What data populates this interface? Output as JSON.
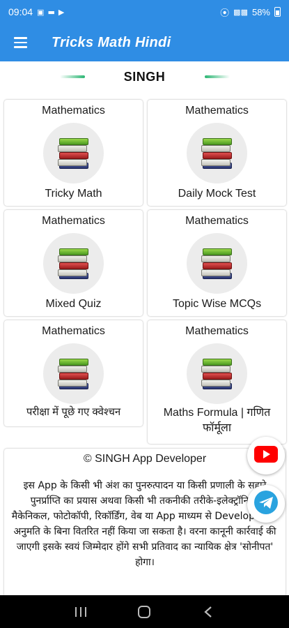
{
  "status_bar": {
    "time": "09:04",
    "battery": "58%"
  },
  "app_bar": {
    "title": "Tricks Math Hindi"
  },
  "section": {
    "title": "SINGH"
  },
  "cards": [
    {
      "category": "Mathematics",
      "label": "Tricky Math"
    },
    {
      "category": "Mathematics",
      "label": "Daily Mock Test"
    },
    {
      "category": "Mathematics",
      "label": "Mixed Quiz"
    },
    {
      "category": "Mathematics",
      "label": "Topic Wise MCQs"
    },
    {
      "category": "Mathematics",
      "label": "परीक्षा में पूछे गए क्वेश्चन"
    },
    {
      "category": "Mathematics",
      "label": "Maths Formula | गणित फॉर्मूला"
    }
  ],
  "footer": {
    "copyright": "© SINGH App Developer",
    "disclaimer": "इस App के किसी भी अंश का पुनरुत्पादन या किसी प्रणाली के सहारे पुनर्प्राप्ति का प्रयास अथवा किसी भी तकनीकी तरीके-इलेक्ट्रॉनिक, मैकेनिकल, फोटोकॉपी, रिकॉर्डिंग, वेब या App माध्यम से Developer की अनुमति के बिना वितरित नहीं किया जा सकता है। वरना कानूनी कार्रवाई की जाएगी इसके स्वयं जिम्मेदार होंगे सभी प्रतिवाद का न्यायिक क्षेत्र 'सोनीपत' होगा।"
  },
  "colors": {
    "primary": "#2f8de4",
    "accent_line": "#2bb673",
    "youtube": "#ff0000",
    "telegram": "#2aa3df"
  },
  "icons": {
    "menu": "hamburger-menu-icon",
    "card": "books-stack-icon",
    "youtube": "youtube-icon",
    "telegram": "telegram-icon"
  }
}
